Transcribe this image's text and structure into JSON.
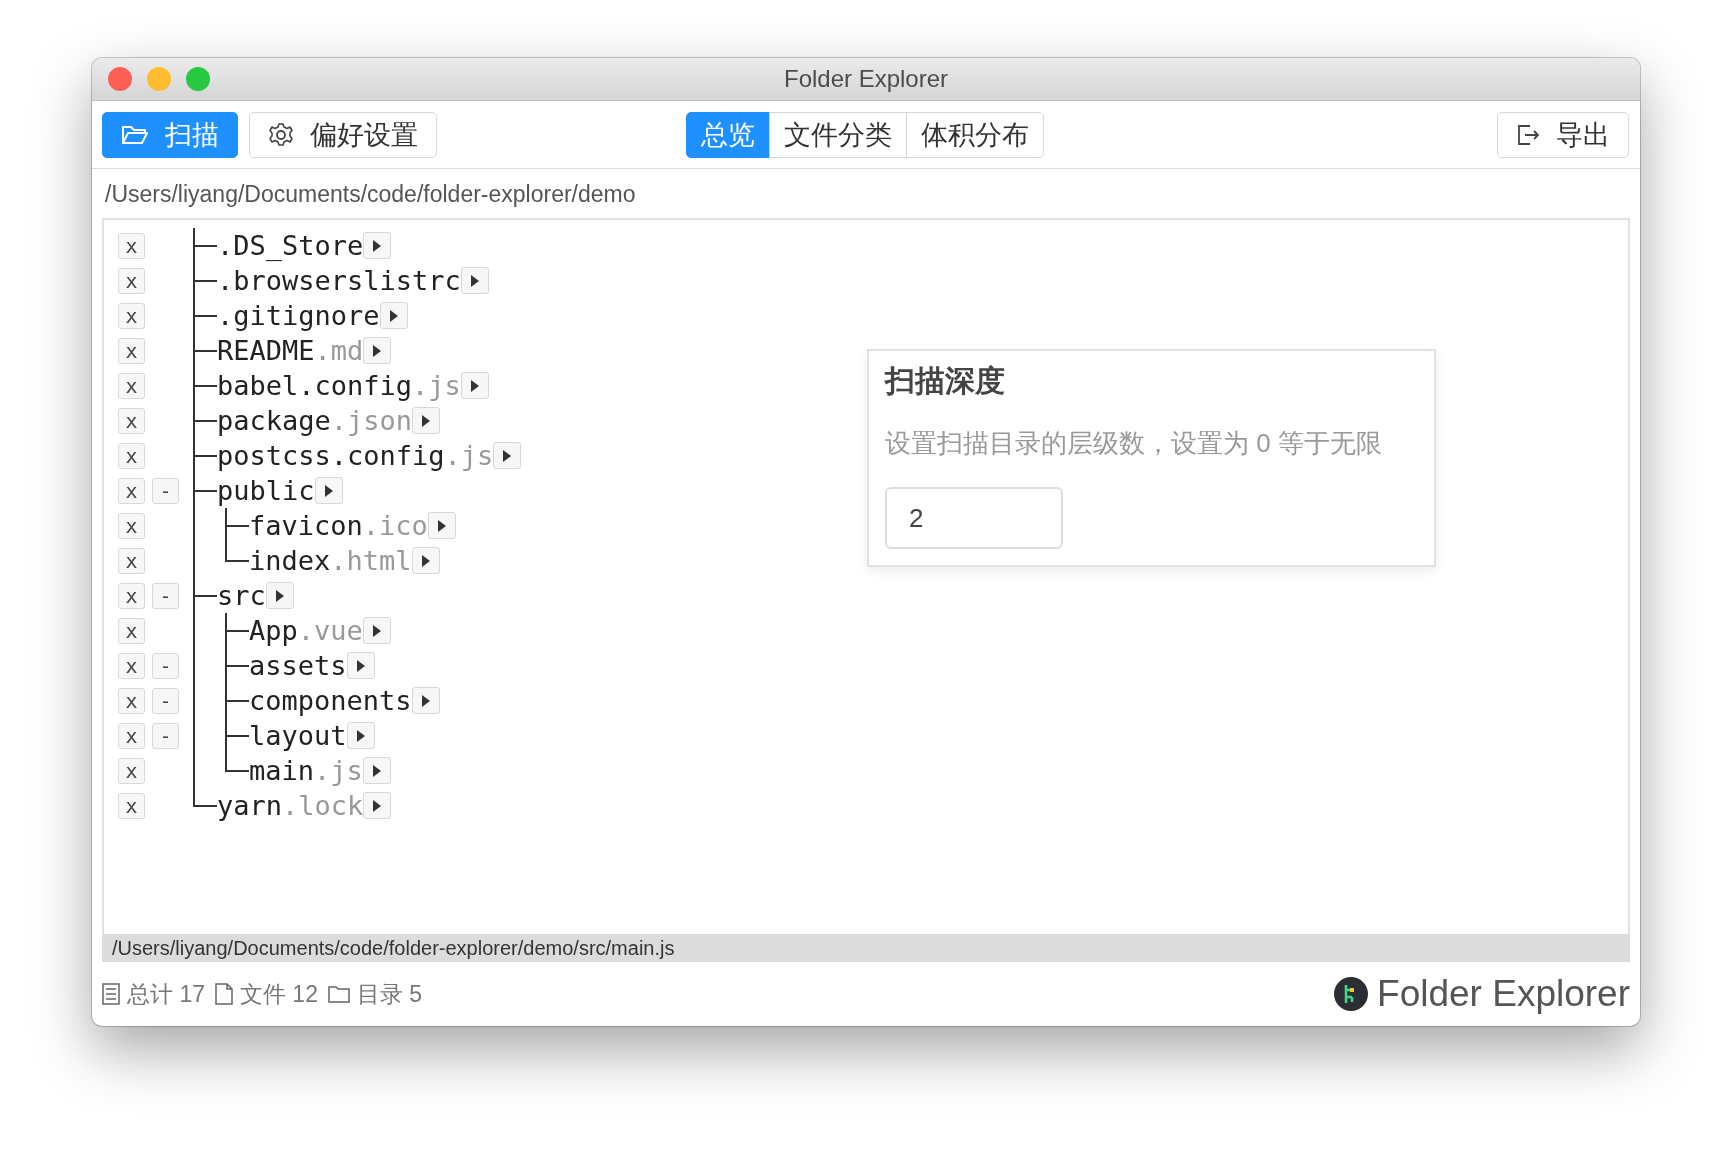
{
  "window": {
    "title": "Folder Explorer"
  },
  "toolbar": {
    "scan_button": "扫描",
    "preferences_button": "偏好设置",
    "export_button": "导出"
  },
  "tabs": [
    {
      "label": "总览",
      "selected": true
    },
    {
      "label": "文件分类",
      "selected": false
    },
    {
      "label": "体积分布",
      "selected": false
    }
  ],
  "path": "/Users/liyang/Documents/code/folder-explorer/demo",
  "tree": [
    {
      "name": ".DS_Store",
      "remove": "x"
    },
    {
      "name": ".browserslistrc",
      "remove": "x"
    },
    {
      "name": ".gitignore",
      "remove": "x"
    },
    {
      "name": "README",
      "ext": ".md",
      "remove": "x"
    },
    {
      "name": "babel.config",
      "ext": ".js",
      "remove": "x"
    },
    {
      "name": "package",
      "ext": ".json",
      "remove": "x"
    },
    {
      "name": "postcss.config",
      "ext": ".js",
      "remove": "x"
    },
    {
      "name": "public",
      "remove": "x",
      "toggle": "-",
      "children": [
        {
          "name": "favicon",
          "ext": ".ico",
          "remove": "x"
        },
        {
          "name": "index",
          "ext": ".html",
          "remove": "x"
        }
      ]
    },
    {
      "name": "src",
      "remove": "x",
      "toggle": "-",
      "children": [
        {
          "name": "App",
          "ext": ".vue",
          "remove": "x"
        },
        {
          "name": "assets",
          "remove": "x",
          "toggle": "-"
        },
        {
          "name": "components",
          "remove": "x",
          "toggle": "-"
        },
        {
          "name": "layout",
          "remove": "x",
          "toggle": "-"
        },
        {
          "name": "main",
          "ext": ".js",
          "remove": "x"
        }
      ]
    },
    {
      "name": "yarn",
      "ext": ".lock",
      "remove": "x"
    }
  ],
  "depth_card": {
    "title": "扫描深度",
    "description": "设置扫描目录的层级数，设置为 0 等于无限",
    "value": "2"
  },
  "status_path": "/Users/liyang/Documents/code/folder-explorer/demo/src/main.js",
  "footer": {
    "stats": [
      {
        "kind": "total",
        "label": "总计 17"
      },
      {
        "kind": "files",
        "label": "文件 12"
      },
      {
        "kind": "folders",
        "label": "目录 5"
      }
    ],
    "brand": "Folder Explorer"
  }
}
